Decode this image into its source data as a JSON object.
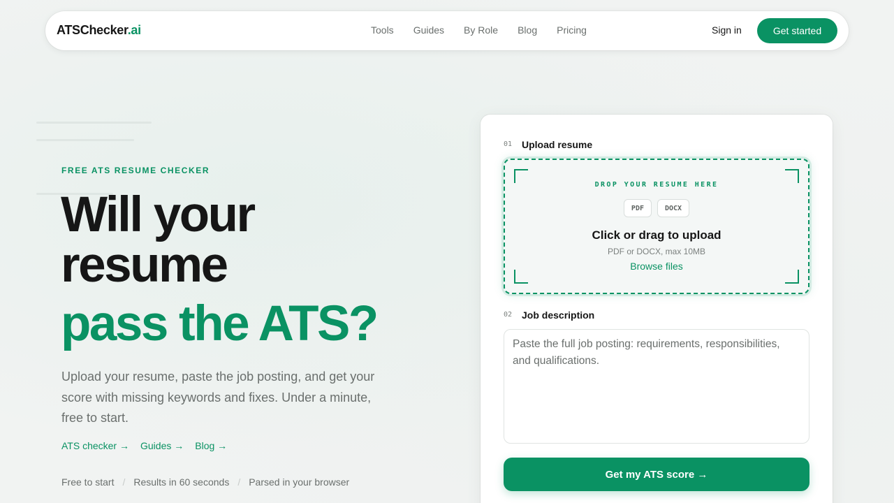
{
  "brand": {
    "name": "ATSChecker",
    "suffix": ".ai"
  },
  "nav": {
    "links": [
      "Tools",
      "Guides",
      "By Role",
      "Blog",
      "Pricing"
    ],
    "signin": "Sign in",
    "cta": "Get started"
  },
  "hero": {
    "eyebrow": "FREE ATS RESUME CHECKER",
    "title_line1": "Will your",
    "title_line2": "resume",
    "title_accent": "pass the ATS?",
    "lede": "Upload your resume, paste the job posting, and get your score with missing keywords and fixes. Under a minute, free to start.",
    "links": [
      "ATS checker →",
      "Guides →",
      "Blog →"
    ],
    "badges": [
      "Free to start",
      "Results in 60 seconds",
      "Parsed in your browser"
    ]
  },
  "form": {
    "step1": {
      "num": "01",
      "label": "Upload resume"
    },
    "dropzone": {
      "title": "DROP YOUR RESUME HERE",
      "formats": [
        "PDF",
        "DOCX"
      ],
      "main": "Click or drag to upload",
      "sub": "PDF or DOCX, max 10MB",
      "browse": "Browse files"
    },
    "step2": {
      "num": "02",
      "label": "Job description"
    },
    "jd_placeholder": "Paste the full job posting: requirements, responsibilities, and qualifications.",
    "jd_value": "",
    "submit": "Get my ATS score →"
  },
  "colors": {
    "accent": "#0a9263",
    "text": "#161616",
    "muted": "#6a6f6d",
    "background": "#f1f3f2"
  }
}
